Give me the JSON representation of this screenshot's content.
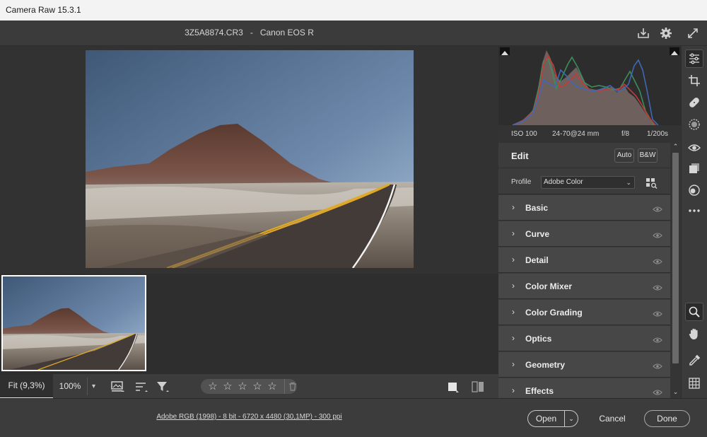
{
  "window": {
    "title": "Camera Raw 15.3.1"
  },
  "header": {
    "filename": "3Z5A8874.CR3",
    "separator": "-",
    "camera": "Canon EOS R"
  },
  "viewer": {
    "zoom_fit_label": "Fit (9,3%)",
    "zoom_100_label": "100%"
  },
  "rating": {
    "stars": [
      "☆",
      "☆",
      "☆",
      "☆",
      "☆"
    ],
    "value": 0
  },
  "histogram": {
    "shadow_clip_icon": "shadow-clipping-icon",
    "highlight_clip_icon": "highlight-clipping-icon"
  },
  "metadata": {
    "iso": "ISO 100",
    "lens": "24-70@24 mm",
    "aperture": "f/8",
    "shutter": "1/200s"
  },
  "edit": {
    "title": "Edit",
    "auto_label": "Auto",
    "bw_label": "B&W"
  },
  "profile": {
    "label": "Profile",
    "value": "Adobe Color"
  },
  "sections": [
    {
      "name": "Basic"
    },
    {
      "name": "Curve"
    },
    {
      "name": "Detail"
    },
    {
      "name": "Color Mixer"
    },
    {
      "name": "Color Grading"
    },
    {
      "name": "Optics"
    },
    {
      "name": "Geometry"
    },
    {
      "name": "Effects"
    }
  ],
  "footer": {
    "file_info": "Adobe RGB (1998) - 8 bit - 6720 x 4480 (30,1MP) - 300 ppi",
    "open_label": "Open",
    "cancel_label": "Cancel",
    "done_label": "Done"
  },
  "colors": {
    "accent": "#ffffff",
    "panel_bg": "#3c3c3c",
    "section_bg": "#474747"
  }
}
